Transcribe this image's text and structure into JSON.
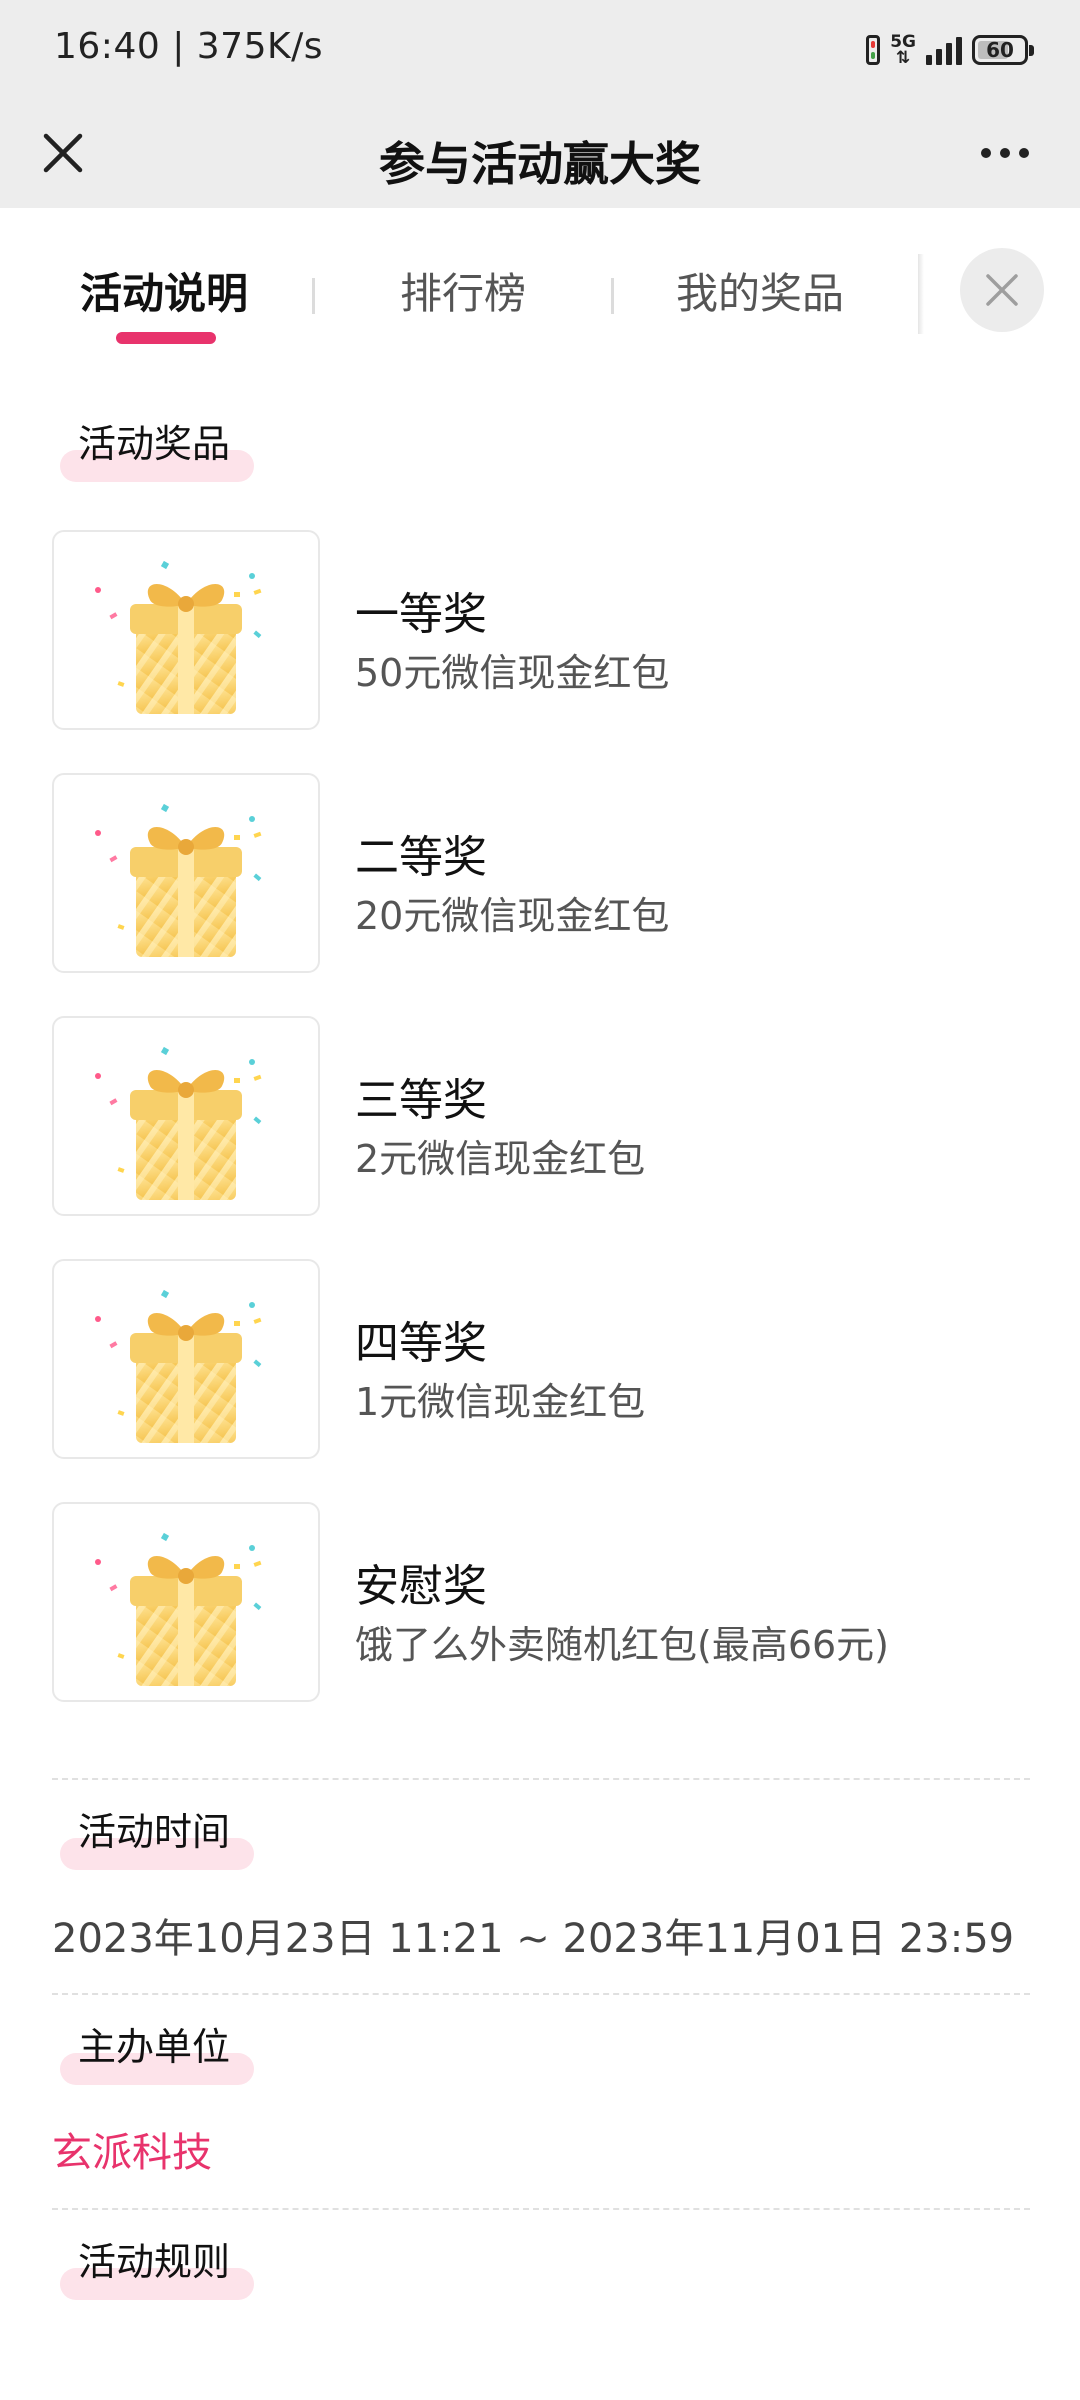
{
  "status_bar": {
    "time": "16:40 | 375K/s",
    "network": "5G",
    "battery": "60"
  },
  "title_bar": {
    "title": "参与活动赢大奖"
  },
  "tabs": [
    {
      "label": "活动说明",
      "active": true
    },
    {
      "label": "排行榜",
      "active": false
    },
    {
      "label": "我的奖品",
      "active": false
    }
  ],
  "sections": {
    "prizes_title": "活动奖品",
    "time_title": "活动时间",
    "organizer_title": "主办单位",
    "rules_title": "活动规则"
  },
  "prizes": [
    {
      "name": "一等奖",
      "desc": "50元微信现金红包"
    },
    {
      "name": "二等奖",
      "desc": "20元微信现金红包"
    },
    {
      "name": "三等奖",
      "desc": "2元微信现金红包"
    },
    {
      "name": "四等奖",
      "desc": "1元微信现金红包"
    },
    {
      "name": "安慰奖",
      "desc": "饿了么外卖随机红包(最高66元)"
    }
  ],
  "activity_time": "2023年10月23日 11:21 ~ 2023年11月01日 23:59",
  "organizer": "玄派科技",
  "colors": {
    "accent": "#e8336c",
    "highlight": "#fde3ea",
    "header_bg": "#ededed"
  },
  "icons": [
    "close-icon",
    "more-icon",
    "gift-icon"
  ]
}
